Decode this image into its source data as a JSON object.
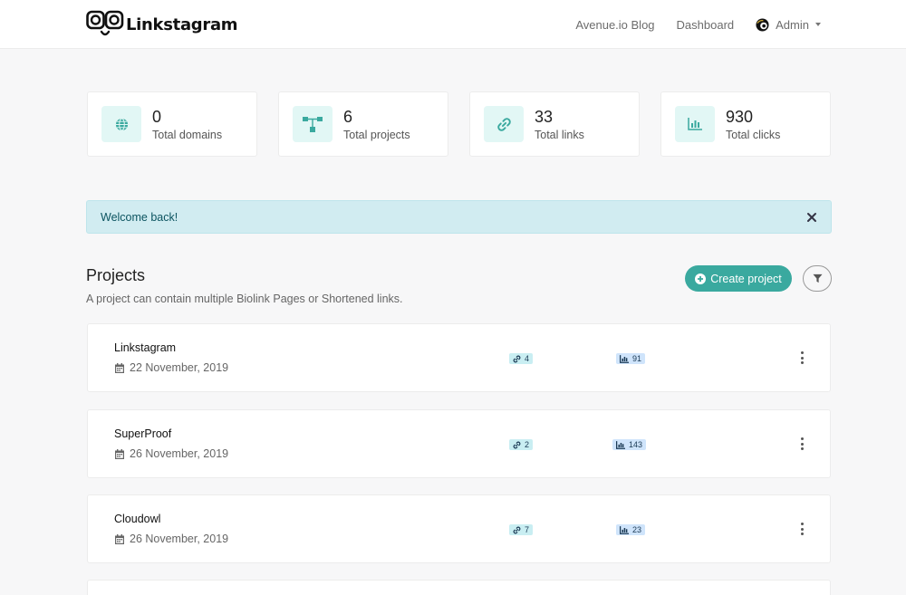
{
  "brand": {
    "name": "Linkstagram"
  },
  "nav": {
    "blog": "Avenue.io Blog",
    "dashboard": "Dashboard",
    "user": "Admin"
  },
  "stats": [
    {
      "value": "0",
      "label": "Total domains",
      "icon": "globe-icon"
    },
    {
      "value": "6",
      "label": "Total projects",
      "icon": "sitemap-icon"
    },
    {
      "value": "33",
      "label": "Total links",
      "icon": "link-icon"
    },
    {
      "value": "930",
      "label": "Total clicks",
      "icon": "chart-bar-icon"
    }
  ],
  "alert": {
    "message": "Welcome back!"
  },
  "projects": {
    "title": "Projects",
    "subtitle": "A project can contain multiple Biolink Pages or Shortened links.",
    "create_label": "Create project",
    "items": [
      {
        "name": "Linkstagram",
        "date": "22 November, 2019",
        "links": "4",
        "clicks": "91"
      },
      {
        "name": "SuperProof",
        "date": "26 November, 2019",
        "links": "2",
        "clicks": "143"
      },
      {
        "name": "Cloudowl",
        "date": "26 November, 2019",
        "links": "7",
        "clicks": "23"
      }
    ]
  },
  "colors": {
    "accent": "#3aa99f",
    "icon_bg": "#e2f7f5",
    "alert_bg": "#d1ecf1",
    "alert_text": "#0c5460"
  }
}
